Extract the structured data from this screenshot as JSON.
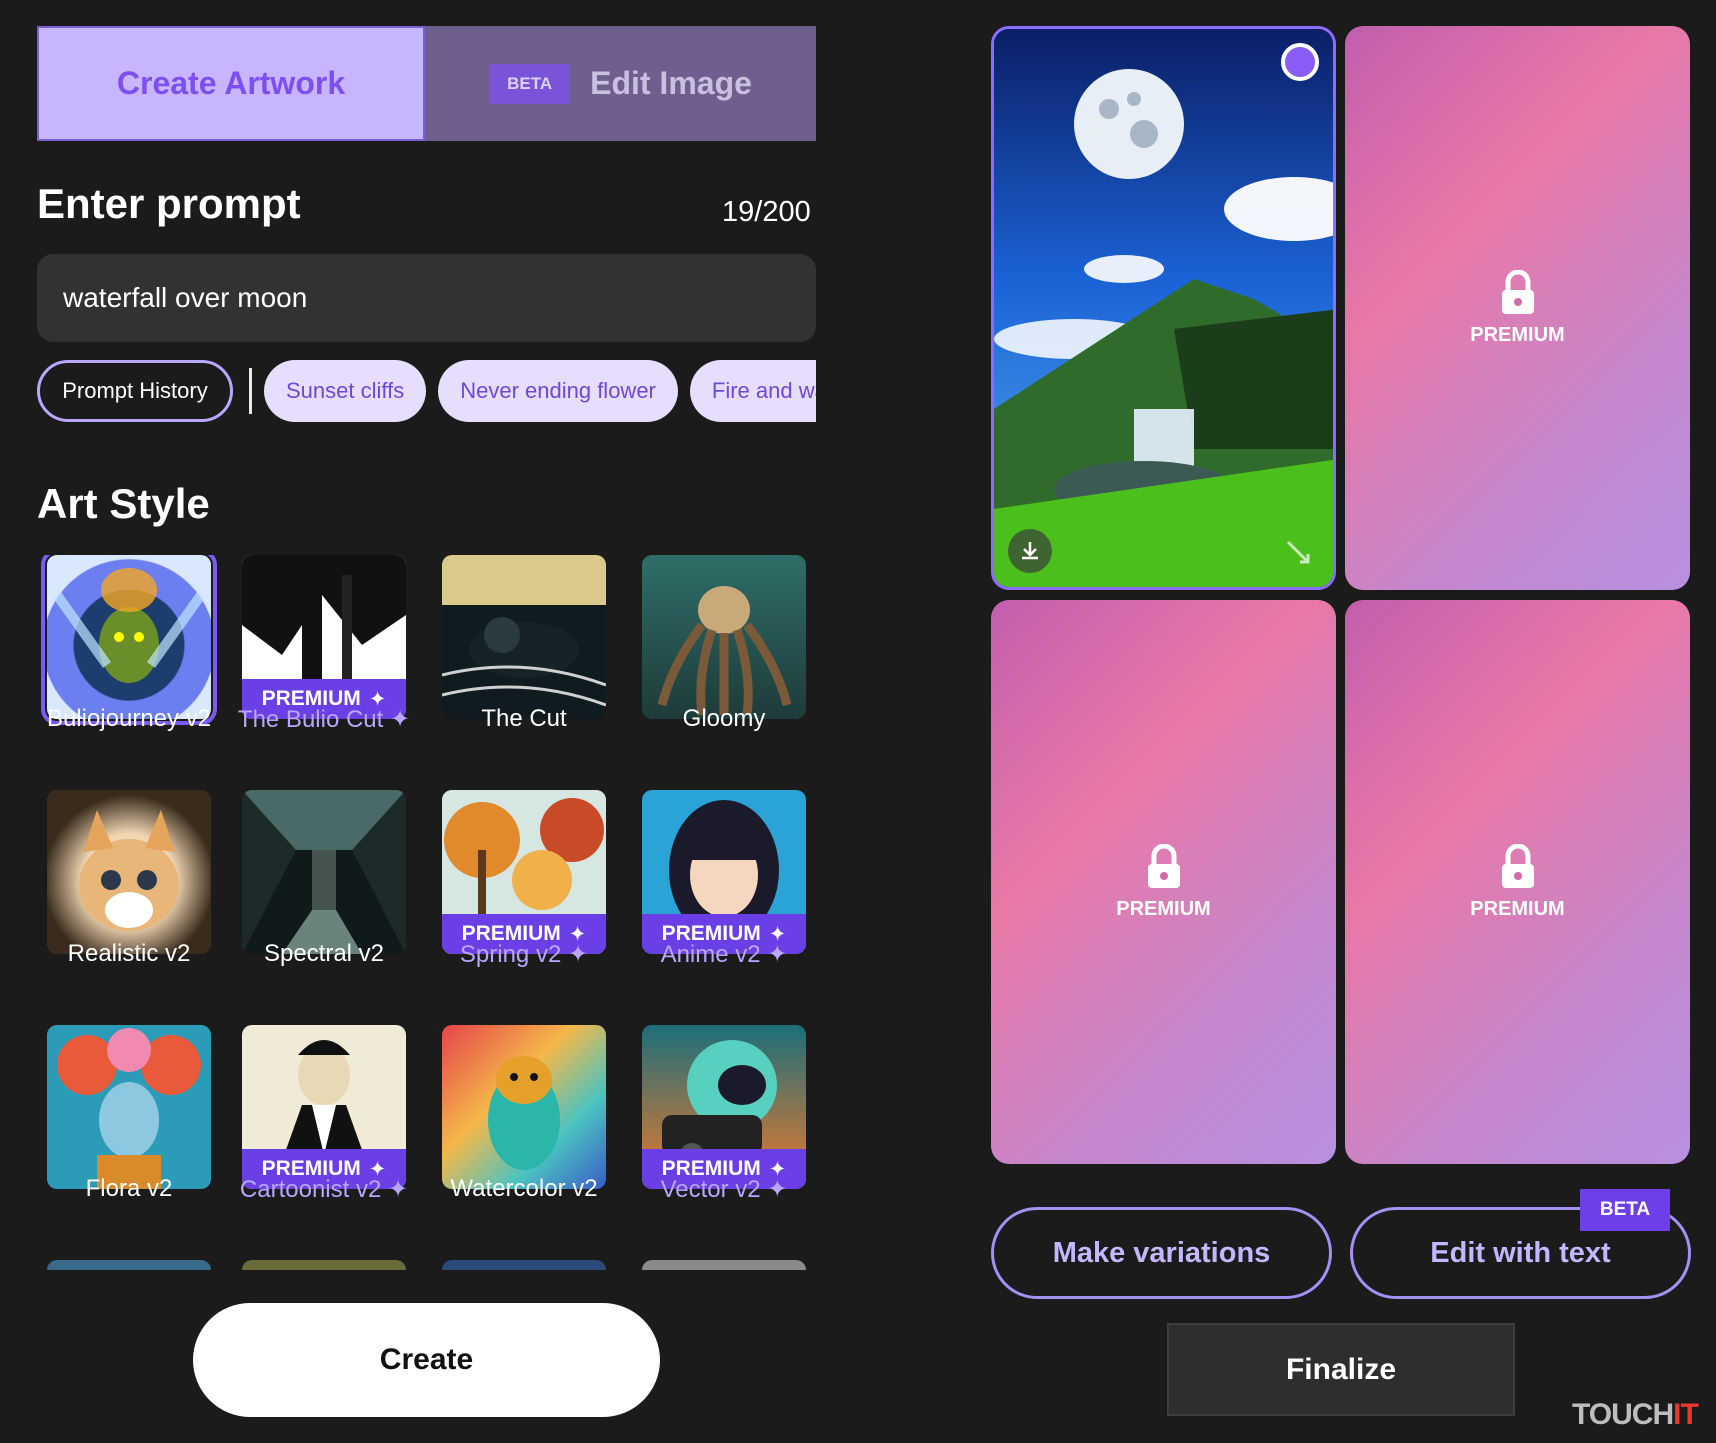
{
  "tabs": {
    "create": "Create Artwork",
    "edit": "Edit Image",
    "edit_badge": "BETA"
  },
  "prompt": {
    "title": "Enter prompt",
    "counter": "19/200",
    "value": "waterfall over moon"
  },
  "chips": {
    "history": "Prompt History",
    "suggestions": [
      "Sunset cliffs",
      "Never ending flower",
      "Fire and wa"
    ]
  },
  "art_style": {
    "title": "Art Style",
    "premium_label": "PREMIUM",
    "styles": [
      {
        "label": "Buliojourney v2",
        "premium": false,
        "selected": true
      },
      {
        "label": "The Bulio Cut",
        "premium": true
      },
      {
        "label": "The Cut",
        "premium": false
      },
      {
        "label": "Gloomy",
        "premium": false
      },
      {
        "label": "Realistic v2",
        "premium": false
      },
      {
        "label": "Spectral v2",
        "premium": false
      },
      {
        "label": "Spring v2",
        "premium": true
      },
      {
        "label": "Anime v2",
        "premium": true
      },
      {
        "label": "Flora v2",
        "premium": false
      },
      {
        "label": "Cartoonist v2",
        "premium": true
      },
      {
        "label": "Watercolor v2",
        "premium": false
      },
      {
        "label": "Vector v2",
        "premium": true
      }
    ]
  },
  "create_button": "Create",
  "results": {
    "locked_label": "PREMIUM"
  },
  "actions": {
    "make_variations": "Make variations",
    "edit_with_text": "Edit with text",
    "edit_badge": "BETA",
    "finalize": "Finalize"
  },
  "watermark": {
    "main": "TOUCH",
    "accent": "IT"
  },
  "colors": {
    "accent": "#7d4ff0",
    "premium_band": "#6a3fe6",
    "background": "#1b1b1b"
  }
}
